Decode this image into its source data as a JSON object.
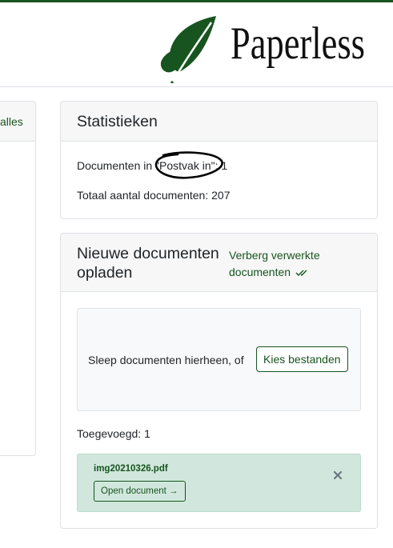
{
  "brand": {
    "name": "Paperless",
    "logo_color": "#17541f"
  },
  "left_panel": {
    "link": "alles"
  },
  "stats": {
    "title": "Statistieken",
    "inbox_line": "Documenten in \"Postvak in\": 1",
    "total_line": "Totaal aantal documenten: 207"
  },
  "upload": {
    "title": "Nieuwe documenten opladen",
    "hide_processed": "Verberg verwerkte documenten",
    "dropzone_text": "Sleep documenten hierheen, of",
    "choose_button": "Kies bestanden",
    "added": "Toegevoegd: 1",
    "file": {
      "name": "img20210326.pdf",
      "open_button": "Open document →"
    }
  },
  "colors": {
    "accent": "#17541f",
    "success_bg": "#d1e7dd",
    "card_header_bg": "#f7f7f7"
  },
  "icons": {
    "logo": "leaf-logo-icon",
    "hide": "double-check-icon",
    "close": "close-icon"
  }
}
